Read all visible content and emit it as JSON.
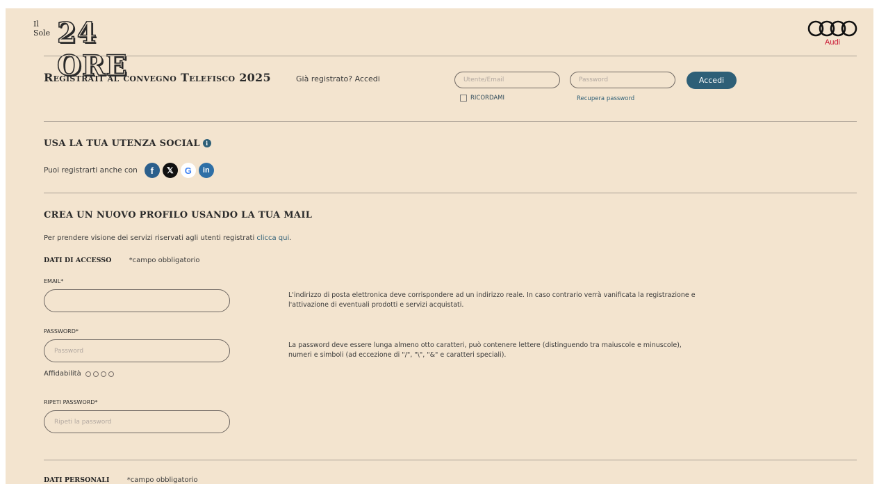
{
  "header": {
    "logo_small": "Il Sole",
    "logo_big": "24 ORE",
    "sponsor": "Audi",
    "sponsor_color": "#c8102e"
  },
  "login": {
    "title": "Registrati al convegno Telefisco 2025",
    "already": "Già registrato? Accedi",
    "user_placeholder": "Utente/Email",
    "password_placeholder": "Password",
    "submit_label": "Accedi",
    "remember_label": "RICORDAMI",
    "recover_label": "Recupera password",
    "accent_color": "#2e5f77"
  },
  "social": {
    "title": "USA LA TUA UTENZA SOCIAL",
    "info_icon": "i",
    "text": "Puoi registrarti anche con",
    "providers": {
      "facebook": "f",
      "x": "𝕏",
      "google": "G",
      "linkedin": "in"
    }
  },
  "create": {
    "title": "CREA UN NUOVO PROFILO USANDO LA TUA MAIL",
    "intro": "Per prendere visione dei servizi riservati agli utenti registrati ",
    "intro_link": "clicca qui",
    "intro_end": ".",
    "access_label": "DATI DI ACCESSO",
    "required_note": "*campo obbligatorio",
    "email_label": "EMAIL*",
    "email_hint": "L'indirizzo di posta elettronica deve corrispondere ad un indirizzo reale. In caso contrario verrà vanificata la registrazione e l'attivazione di eventuali prodotti e servizi acquistati.",
    "password_label": "PASSWORD*",
    "password_placeholder": "Password",
    "password_hint": "La password deve essere lunga almeno otto caratteri, può contenere lettere (distinguendo tra maiuscole e minuscole), numeri e simboli (ad eccezione di \"/\", \"\\\", \"&\" e caratteri speciali).",
    "reliability_label": "Affidabilità",
    "repeat_label": "RIPETI PASSWORD*",
    "repeat_placeholder": "Ripeti la password"
  },
  "personal": {
    "label": "DATI PERSONALI",
    "required_note": "*campo obbligatorio"
  }
}
